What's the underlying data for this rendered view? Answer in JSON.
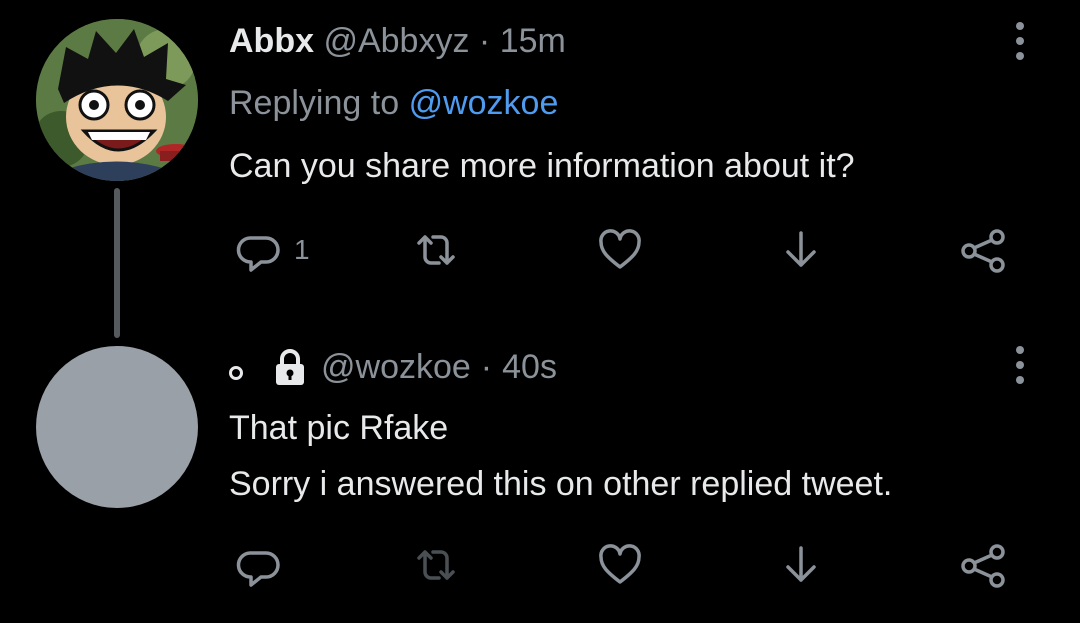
{
  "tweet1": {
    "display_name": "Abbx",
    "handle": "@Abbxyz",
    "separator": "·",
    "time": "15m",
    "replying_prefix": "Replying to",
    "replying_handle": "@wozkoe",
    "text": "Can you share more information about it?",
    "reply_count": "1"
  },
  "tweet2": {
    "handle": "@wozkoe",
    "separator": "·",
    "time": "40s",
    "text_line1": "That pic Rfake",
    "text_line2": "Sorry i answered this on other replied tweet."
  },
  "icons": [
    "more-icon",
    "reply-icon",
    "retweet-icon",
    "like-icon",
    "download-icon",
    "share-icon",
    "lock-icon"
  ],
  "colors": {
    "background": "#000000",
    "text": "#e7e9ea",
    "muted": "#8b9299",
    "link": "#4f9bf0"
  }
}
